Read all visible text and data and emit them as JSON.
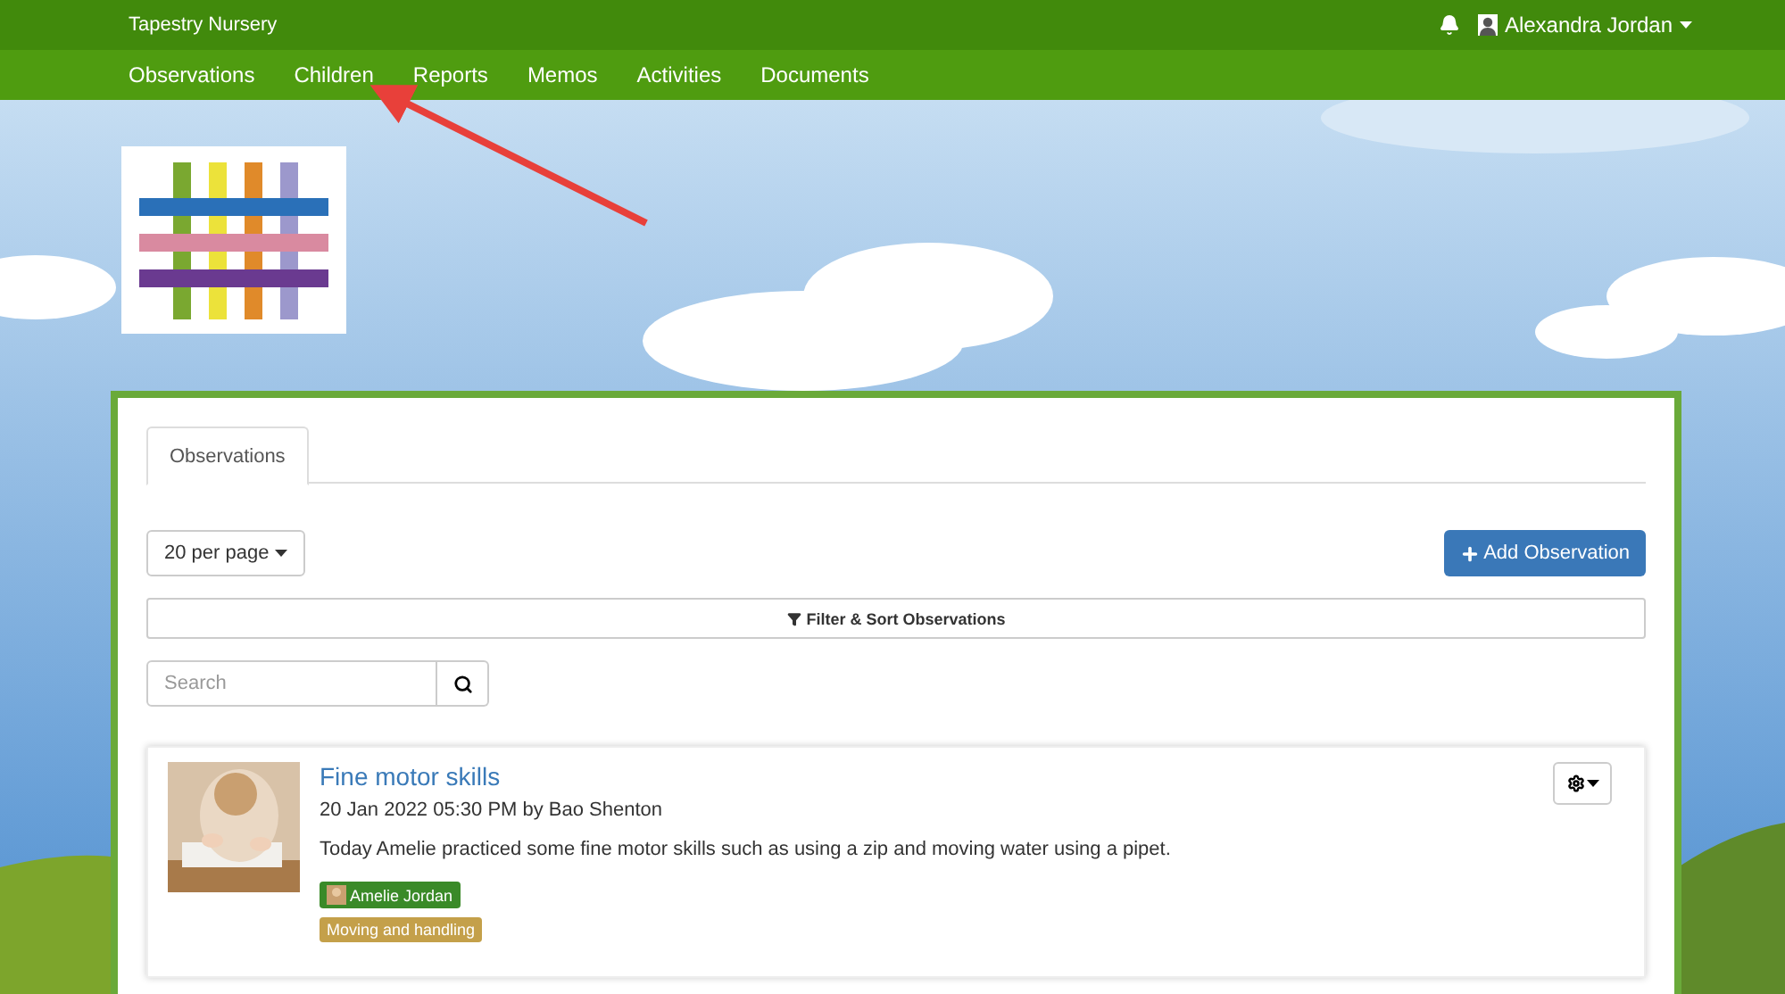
{
  "top_bar": {
    "site_name": "Tapestry Nursery",
    "user_name": "Alexandra Jordan"
  },
  "nav": {
    "items": [
      "Observations",
      "Children",
      "Reports",
      "Memos",
      "Activities",
      "Documents"
    ]
  },
  "tabs": [
    {
      "label": "Observations",
      "selected": true
    }
  ],
  "toolbar": {
    "per_page": "20 per page",
    "add_button": "Add Observation",
    "filter_button": "Filter & Sort Observations",
    "search": {
      "placeholder": "Search"
    }
  },
  "observations": [
    {
      "title": "Fine motor skills",
      "meta": "20 Jan 2022 05:30 PM by Bao Shenton",
      "text": "Today Amelie practiced some fine motor skills such as using a zip and moving water using a pipet.",
      "tags": [
        {
          "kind": "child",
          "label": "Amelie Jordan",
          "color": "#3a8a28"
        },
        {
          "kind": "area",
          "label": "Moving and handling",
          "color": "#c4a04a"
        }
      ]
    }
  ]
}
